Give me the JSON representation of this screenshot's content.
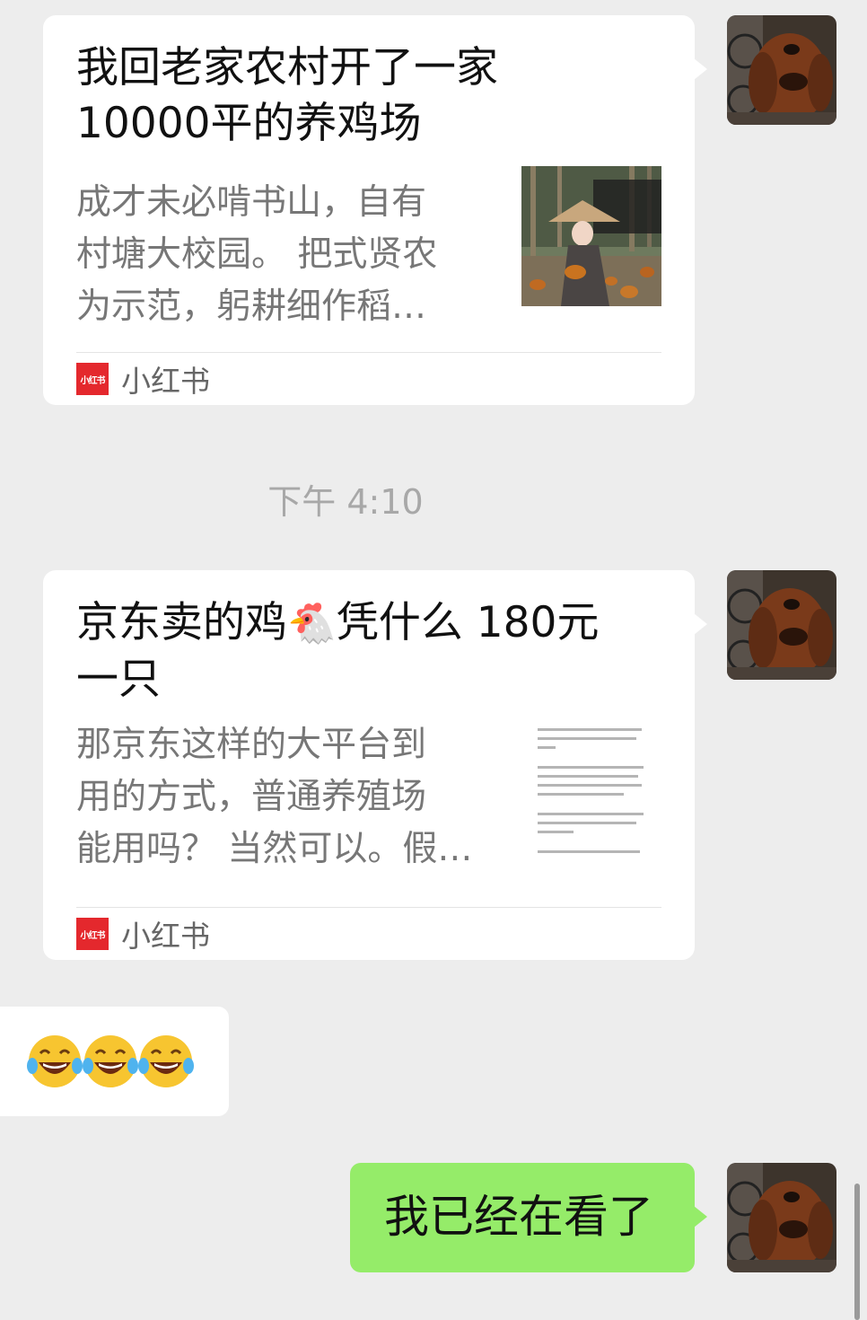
{
  "messages": [
    {
      "type": "link_card",
      "title": "我回老家农村开了一家\n10000平的养鸡场",
      "description": "成才未必啃书山，自有\n村塘大校园。 把式贤农\n为示范，躬耕细作稻…",
      "source": "小红书",
      "source_logo_text": "小红书",
      "thumbnail_icon": "woman-in-conical-hat-with-chickens-image"
    },
    {
      "type": "timestamp",
      "text": "下午 4:10"
    },
    {
      "type": "link_card",
      "title": "京东卖的鸡\n凭什么 180元\n一只",
      "title_line1_prefix": "京东卖的鸡",
      "title_line1_emoji": "🐔",
      "title_line1_suffix": "凭什么 180元",
      "title_line2": "一只",
      "description": "那京东这样的大平台到\n用的方式，普通养殖场\n能用吗？ 当然可以。假…",
      "source": "小红书",
      "source_logo_text": "小红书",
      "thumbnail_icon": "text-document-preview-image"
    },
    {
      "type": "emoji",
      "text": "😂😂😂"
    },
    {
      "type": "text",
      "text": "我已经在看了"
    }
  ],
  "colors": {
    "background": "#ededed",
    "bubble_white": "#ffffff",
    "bubble_green": "#95ec69",
    "xhs_red": "#e4282d",
    "meta_gray": "#a8a8a8"
  },
  "avatar_icon": "dog-avatar"
}
